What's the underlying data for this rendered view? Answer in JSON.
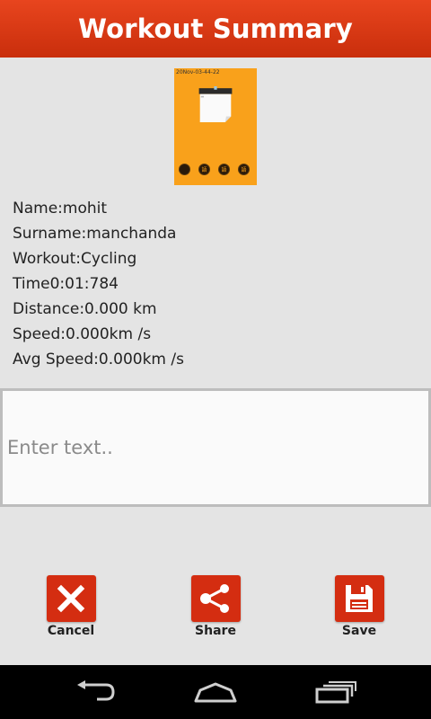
{
  "header": {
    "title": "Workout Summary"
  },
  "thumbnail": {
    "date_text": "20Nov-03-44-22",
    "buttons": [
      "s",
      "語",
      "語",
      "語"
    ]
  },
  "info": {
    "name": "Name:mohit",
    "surname": "Surname:manchanda",
    "workout": "Workout:Cycling",
    "time": "Time0:01:784",
    "distance": "Distance:0.000 km",
    "speed": "Speed:0.000km /s",
    "avg_speed": "Avg Speed:0.000km /s"
  },
  "note": {
    "placeholder": "Enter text..",
    "value": ""
  },
  "actions": {
    "cancel": {
      "label": "Cancel",
      "icon": "close-icon"
    },
    "share": {
      "label": "Share",
      "icon": "share-icon"
    },
    "save": {
      "label": "Save",
      "icon": "floppy-disk-icon"
    }
  },
  "navbar": {
    "icons": [
      "back-icon",
      "home-icon",
      "recent-apps-icon"
    ]
  },
  "colors": {
    "header": "#d8390f",
    "accent": "#d42d11",
    "thumbnail_bg": "#f9a11b",
    "background": "#e4e4e4"
  }
}
